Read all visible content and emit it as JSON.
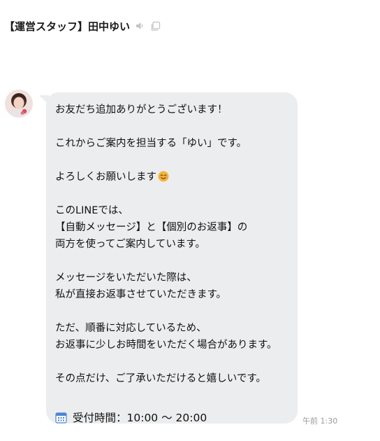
{
  "header": {
    "title": "【運営スタッフ】田中ゆい",
    "icons": [
      "speaker-icon",
      "copy-window-icon"
    ]
  },
  "message": {
    "lines": [
      "お友だち追加ありがとうございます！",
      "",
      "これからご案内を担当する「ゆい」です。",
      "",
      "よろしくお願いします",
      "",
      "このLINEでは、",
      "【自動メッセージ】と【個別のお返事】の",
      "両方を使ってご案内しています。",
      "",
      "メッセージをいただいた際は、",
      "私が直接お返事させていただきます。",
      "",
      "ただ、順番に対応しているため、",
      "お返事に少しお時間をいただく場合があります。",
      "",
      "その点だけ、ご了承いただけると嬉しいです。"
    ],
    "emoji_after_line_5": "smiling-face-emoji",
    "hours": "受付時間：10:00 〜 20:00",
    "hours_icon": "calendar-icon",
    "timestamp": "午前 1:30"
  },
  "colors": {
    "bubble": "#ecedef",
    "timestamp": "#9a9a9a",
    "title": "#1a1a1a"
  }
}
